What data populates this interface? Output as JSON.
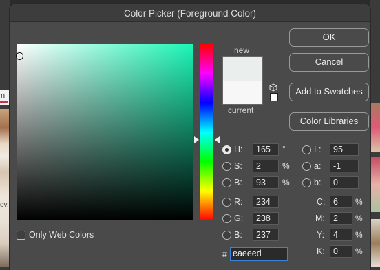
{
  "dialog": {
    "title": "Color Picker (Foreground Color)",
    "buttons": {
      "ok": "OK",
      "cancel": "Cancel",
      "add_to_swatches": "Add to Swatches",
      "color_libraries": "Color Libraries"
    }
  },
  "swatch": {
    "new_label": "new",
    "current_label": "current",
    "new_color": "#eaeeed",
    "current_color": "#f7f7f7"
  },
  "hsb": {
    "h": {
      "label": "H:",
      "value": "165",
      "unit": "°",
      "selected": true
    },
    "s": {
      "label": "S:",
      "value": "2",
      "unit": "%"
    },
    "b": {
      "label": "B:",
      "value": "93",
      "unit": "%"
    }
  },
  "lab": {
    "l": {
      "label": "L:",
      "value": "95"
    },
    "a": {
      "label": "a:",
      "value": "-1"
    },
    "b": {
      "label": "b:",
      "value": "0"
    }
  },
  "rgb": {
    "r": {
      "label": "R:",
      "value": "234"
    },
    "g": {
      "label": "G:",
      "value": "238"
    },
    "b": {
      "label": "B:",
      "value": "237"
    }
  },
  "cmyk": {
    "c": {
      "label": "C:",
      "value": "6",
      "unit": "%"
    },
    "m": {
      "label": "M:",
      "value": "2",
      "unit": "%"
    },
    "y": {
      "label": "Y:",
      "value": "4",
      "unit": "%"
    },
    "k": {
      "label": "K:",
      "value": "0",
      "unit": "%"
    }
  },
  "hex": {
    "label": "#",
    "value": "eaeeed"
  },
  "web_colors": {
    "label": "Only Web Colors",
    "checked": false
  },
  "background": {
    "tab_fragment": "n",
    "text_fragment": "ov."
  },
  "colors": {
    "hue_base": "#1bf5b5",
    "focus_ring": "#3b82d6",
    "dialog_bg": "#4a4a4a"
  }
}
